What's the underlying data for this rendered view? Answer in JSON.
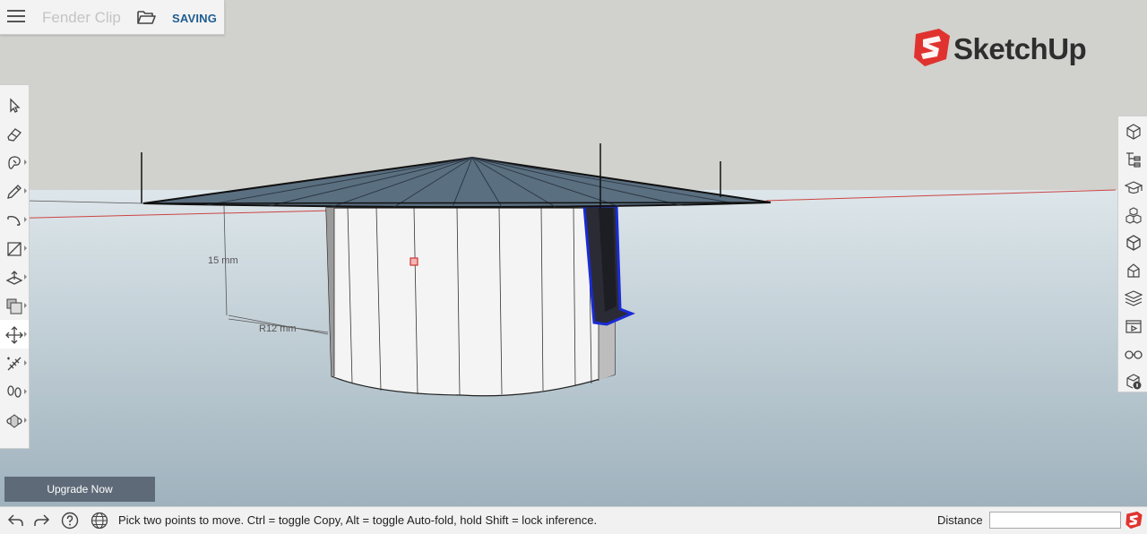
{
  "header": {
    "document_title": "Fender Clip",
    "save_status": "SAVING"
  },
  "brand": {
    "logo_text": "SketchUp",
    "accent_color": "#e0332f"
  },
  "dimensions": {
    "height_label": "15 mm",
    "radius_label": "R12 mm"
  },
  "left_toolbar": [
    {
      "name": "select-tool",
      "icon": "arrow-cursor-icon"
    },
    {
      "name": "eraser-tool",
      "icon": "eraser-icon"
    },
    {
      "name": "paint-bucket-tool",
      "icon": "paint-icon"
    },
    {
      "name": "line-tool",
      "icon": "pencil-icon"
    },
    {
      "name": "arc-tool",
      "icon": "arc-icon"
    },
    {
      "name": "rectangle-tool",
      "icon": "rectangle-icon"
    },
    {
      "name": "push-pull-tool",
      "icon": "push-pull-icon"
    },
    {
      "name": "offset-tool",
      "icon": "offset-icon"
    },
    {
      "name": "move-tool",
      "icon": "move-icon",
      "active": true
    },
    {
      "name": "tape-measure-tool",
      "icon": "tape-measure-icon"
    },
    {
      "name": "walk-tool",
      "icon": "footprints-icon"
    },
    {
      "name": "orbit-tool",
      "icon": "orbit-icon"
    }
  ],
  "right_toolbar": [
    {
      "name": "entity-info-panel",
      "icon": "cube-info-icon"
    },
    {
      "name": "outliner-panel",
      "icon": "outliner-icon"
    },
    {
      "name": "instructor-panel",
      "icon": "mortarboard-icon"
    },
    {
      "name": "components-panel",
      "icon": "components-icon"
    },
    {
      "name": "materials-panel",
      "icon": "materials-cube-icon"
    },
    {
      "name": "styles-panel",
      "icon": "styles-icon"
    },
    {
      "name": "layers-panel",
      "icon": "layers-icon"
    },
    {
      "name": "scenes-panel",
      "icon": "scenes-icon"
    },
    {
      "name": "display-panel",
      "icon": "glasses-icon"
    },
    {
      "name": "model-info-panel",
      "icon": "model-info-icon"
    }
  ],
  "upgrade_button": "Upgrade Now",
  "status_bar": {
    "instruction": "Pick two points to move. Ctrl = toggle Copy, Alt = toggle Auto-fold, hold Shift = lock inference.",
    "measurement_label": "Distance",
    "measurement_value": ""
  }
}
